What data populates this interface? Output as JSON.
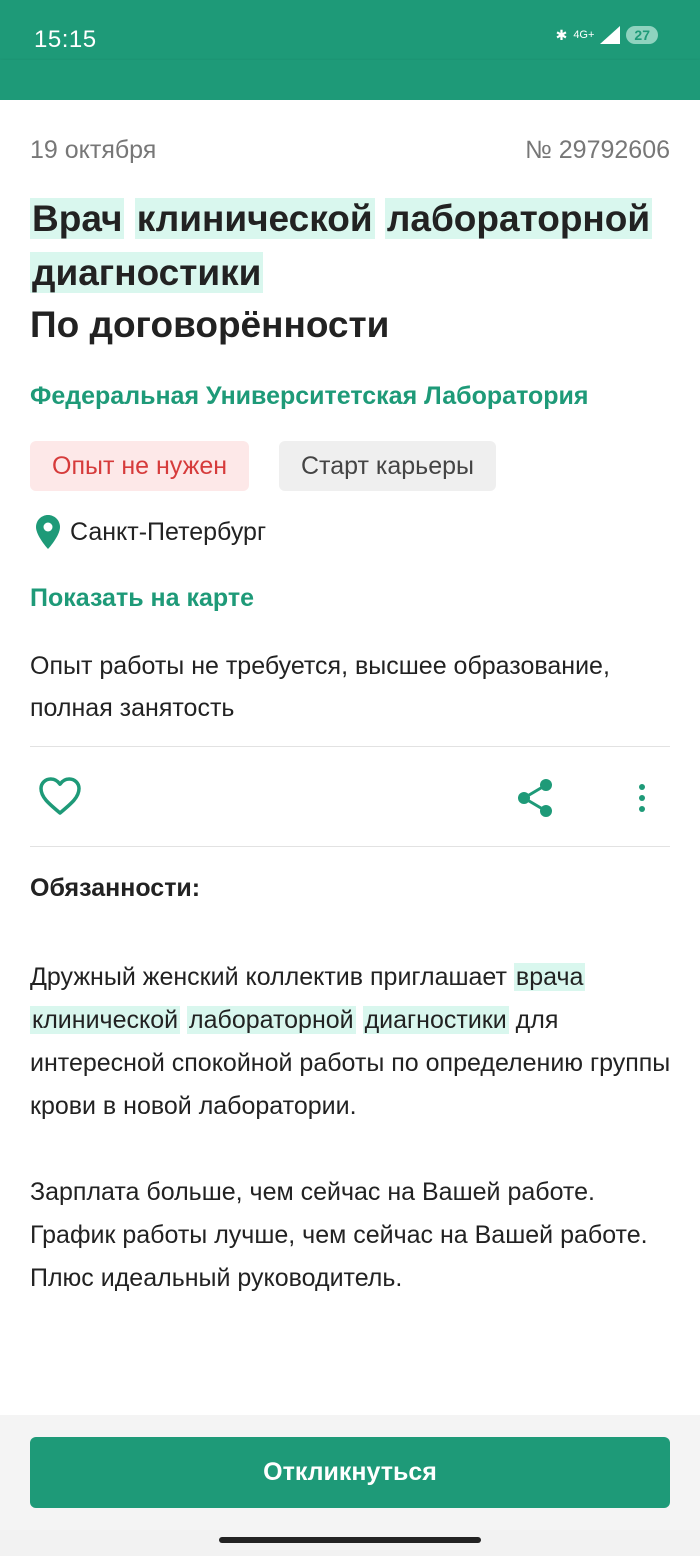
{
  "status_bar": {
    "time": "15:15",
    "network": "4G+",
    "battery": "27"
  },
  "vacancy": {
    "date": "19 октября",
    "number": "№ 29792606",
    "title_words": [
      "Врач",
      "клинической",
      "лабораторной",
      "диагностики"
    ],
    "salary": "По договорённости",
    "company": "Федеральная Университетская Лаборатория",
    "tags": [
      "Опыт не нужен",
      "Старт карьеры"
    ],
    "location": "Санкт-Петербург",
    "show_map": "Показать на карте",
    "summary": "Опыт работы не требуется, высшее образование, полная занятость"
  },
  "actions": {
    "favorite_icon": "heart-icon",
    "share_icon": "share-icon",
    "more_icon": "more-vert-icon"
  },
  "description": {
    "heading": "Обязанности:",
    "p1_start": "Дружный женский коллектив приглашает ",
    "p1_hl1": "врача",
    "p1_hl2": "клинической",
    "p1_hl3": "лабораторной",
    "p1_hl4": "диагностики",
    "p1_end": " для интересной спокойной работы по определению группы крови в новой лаборатории.",
    "p2_l1": "Зарплата больше, чем сейчас на Вашей работе.",
    "p2_l2": "График работы лучше, чем сейчас на Вашей работе.",
    "p2_l3": "Плюс идеальный руководитель."
  },
  "cta": {
    "label": "Откликнуться"
  },
  "colors": {
    "brand": "#1e9a78",
    "highlight": "#d9f7ee",
    "tag_red_bg": "#fde8e8",
    "tag_red_text": "#d63b3b"
  }
}
